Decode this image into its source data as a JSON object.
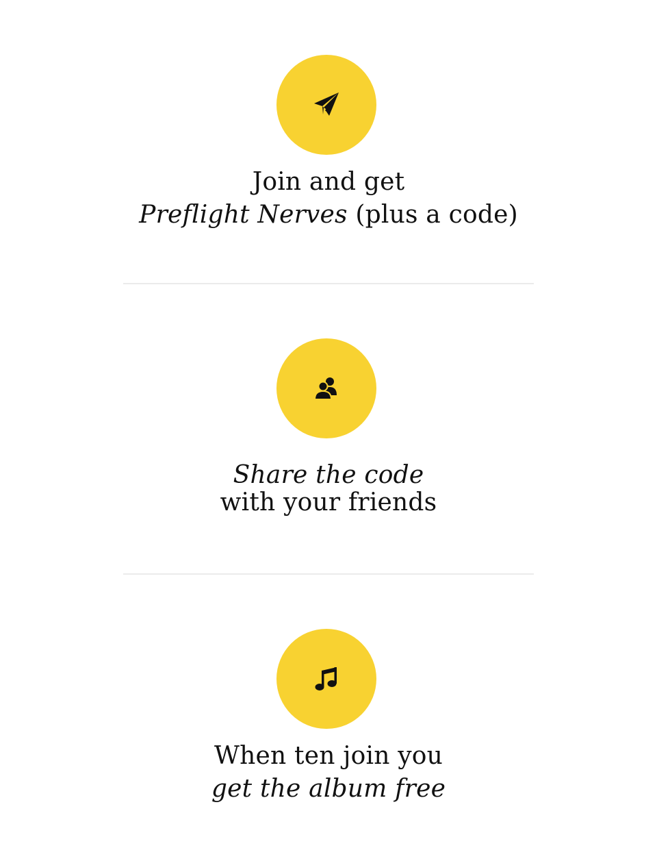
{
  "colors": {
    "accent_circle": "#f8d231",
    "icon": "#111111",
    "text": "#111111",
    "divider": "#ebebeb"
  },
  "steps": [
    {
      "icon": "paper-plane-icon",
      "line1": "Join and get",
      "line2_italic": "Preflight Nerves",
      "line2_rest": " (plus a code)"
    },
    {
      "icon": "users-icon",
      "line1_italic": "Share the code",
      "line2": "with your friends"
    },
    {
      "icon": "music-note-icon",
      "line1": "When ten join you",
      "line2_italic": "get the album free"
    }
  ]
}
